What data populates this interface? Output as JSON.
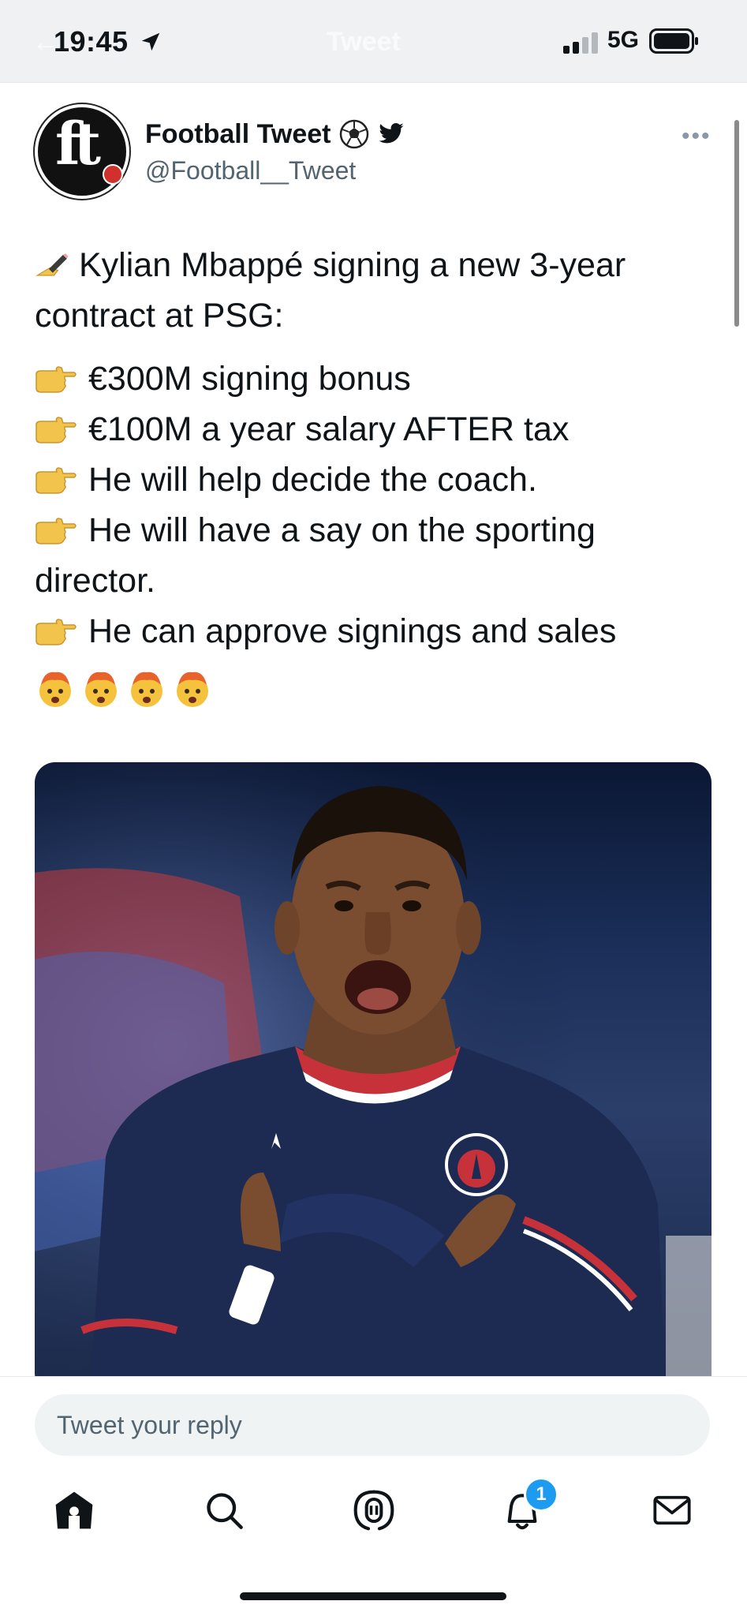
{
  "status_bar": {
    "time": "19:45",
    "network": "5G",
    "ghost_title": "Tweet"
  },
  "tweet": {
    "author_name": "Football Tweet",
    "author_handle": "@Football__Tweet",
    "avatar_text": "ft",
    "more_label": "•••",
    "intro": "Kylian Mbappé signing a new 3-year contract at PSG:",
    "points": [
      "€300M signing bonus",
      "€100M a year salary AFTER tax",
      "He will help decide the coach.",
      "He will have a say on the sporting director.",
      "He can approve signings and sales"
    ],
    "emoji_reaction_count": 4,
    "image_icon": "person-photo"
  },
  "reply": {
    "placeholder": "Tweet your reply"
  },
  "tabs": [
    {
      "name": "home",
      "icon": "home-icon"
    },
    {
      "name": "search",
      "icon": "search-icon"
    },
    {
      "name": "spaces",
      "icon": "spaces-icon"
    },
    {
      "name": "notifications",
      "icon": "bell-icon",
      "badge": "1"
    },
    {
      "name": "messages",
      "icon": "mail-icon"
    }
  ],
  "colors": {
    "accent": "#1d9bf0",
    "text": "#0f1419",
    "secondary_text": "#536471"
  }
}
